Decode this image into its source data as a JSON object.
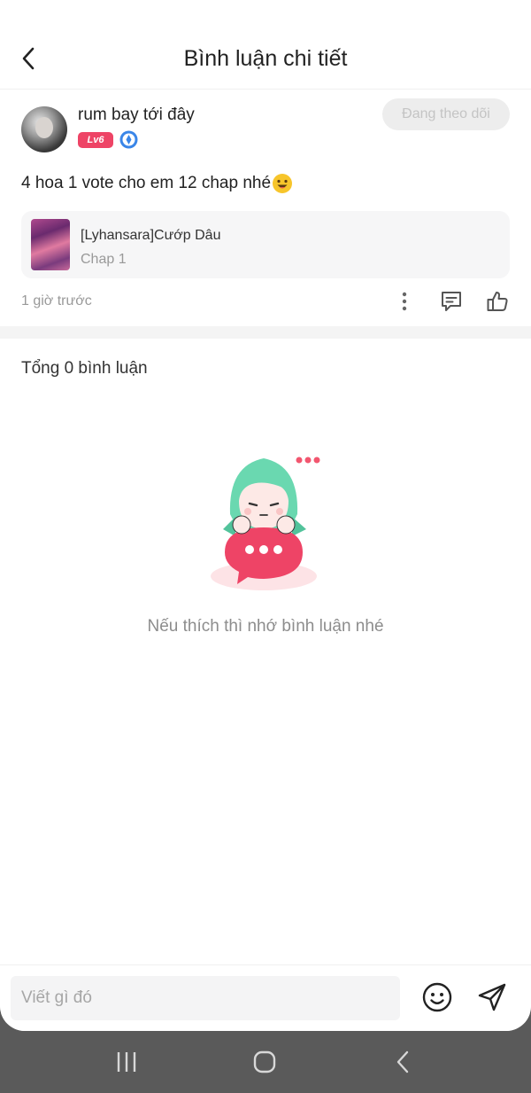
{
  "header": {
    "title": "Bình luận chi tiết",
    "back_icon": "chevron-left-icon"
  },
  "post": {
    "author": {
      "name": "rum bay tới đây",
      "level": "Lv6",
      "verified_icon": "shield-badge-icon",
      "follow_label": "Đang theo dõi"
    },
    "comment": "4 hoa 1 vote cho em 12 chap nhé",
    "comment_emoji": "grinning-face-icon",
    "story": {
      "title": "[Lyhansara]Cướp Dâu",
      "chapter": "Chap 1"
    },
    "time": "1 giờ trước",
    "actions": [
      "more-vertical-icon",
      "reply-comment-icon",
      "thumbs-up-icon"
    ]
  },
  "comments": {
    "total_label": "Tổng 0 bình luận",
    "empty_text": "Nếu thích thì nhớ bình luận nhé"
  },
  "input": {
    "placeholder": "Viết gì đó",
    "value": "",
    "emoji_icon": "smiley-icon",
    "send_icon": "send-icon"
  },
  "colors": {
    "accent": "#ee4466",
    "text": "#222222",
    "muted": "#999999",
    "mascot_hair": "#6ad8b0",
    "nav_bar": "#5a5a5a"
  },
  "system_nav": [
    "recents-icon",
    "home-icon",
    "back-icon"
  ]
}
